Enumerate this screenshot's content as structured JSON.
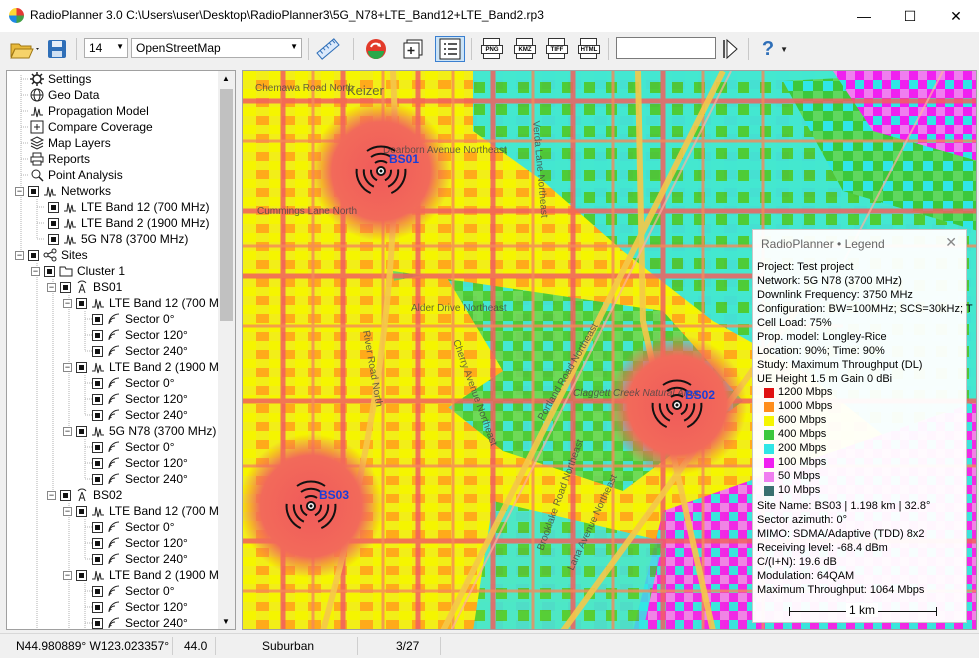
{
  "window": {
    "title": "RadioPlanner 3.0 C:\\Users\\user\\Desktop\\RadioPlanner3\\5G_N78+LTE_Band12+LTE_Band2.rp3",
    "minimize": "—",
    "maximize": "☐",
    "close": "✕"
  },
  "toolbar": {
    "zoom_value": "14",
    "map_source": "OpenStreetMap",
    "export_formats": [
      "PNG",
      "KMZ",
      "TIFF",
      "HTML"
    ],
    "search_value": "",
    "help_icon": "?"
  },
  "tree": {
    "items": [
      {
        "label": "Settings",
        "icon": "gear-icon"
      },
      {
        "label": "Geo Data",
        "icon": "globe-icon"
      },
      {
        "label": "Propagation Model",
        "icon": "wave-icon"
      },
      {
        "label": "Compare Coverage",
        "icon": "compare-icon"
      },
      {
        "label": "Map Layers",
        "icon": "layers-icon"
      },
      {
        "label": "Reports",
        "icon": "printer-icon"
      },
      {
        "label": "Point Analysis",
        "icon": "point-icon"
      },
      {
        "label": "Networks",
        "icon": "network-icon"
      },
      {
        "label": "LTE Band 12 (700 MHz)",
        "icon": "signal-icon"
      },
      {
        "label": "LTE Band 2 (1900 MHz)",
        "icon": "signal-icon"
      },
      {
        "label": "5G N78 (3700 MHz)",
        "icon": "signal-icon"
      },
      {
        "label": "Sites",
        "icon": "share-icon"
      },
      {
        "label": "Cluster 1",
        "icon": "folder-icon"
      },
      {
        "label": "BS01",
        "icon": "antenna-icon"
      },
      {
        "label": "LTE Band 12 (700 M",
        "icon": "signal-icon"
      },
      {
        "label": "Sector 0°",
        "icon": "sector-icon"
      },
      {
        "label": "Sector 120°",
        "icon": "sector-icon"
      },
      {
        "label": "Sector 240°",
        "icon": "sector-icon"
      },
      {
        "label": "LTE Band 2 (1900 M",
        "icon": "signal-icon"
      },
      {
        "label": "Sector 0°",
        "icon": "sector-icon"
      },
      {
        "label": "Sector 120°",
        "icon": "sector-icon"
      },
      {
        "label": "Sector 240°",
        "icon": "sector-icon"
      },
      {
        "label": "5G N78 (3700 MHz)",
        "icon": "signal-icon"
      },
      {
        "label": "Sector 0°",
        "icon": "sector-icon"
      },
      {
        "label": "Sector 120°",
        "icon": "sector-icon"
      },
      {
        "label": "Sector 240°",
        "icon": "sector-icon"
      },
      {
        "label": "BS02",
        "icon": "antenna-icon"
      },
      {
        "label": "LTE Band 12 (700 M",
        "icon": "signal-icon"
      },
      {
        "label": "Sector 0°",
        "icon": "sector-icon"
      },
      {
        "label": "Sector 120°",
        "icon": "sector-icon"
      },
      {
        "label": "Sector 240°",
        "icon": "sector-icon"
      },
      {
        "label": "LTE Band 2 (1900 M",
        "icon": "signal-icon"
      },
      {
        "label": "Sector 0°",
        "icon": "sector-icon"
      },
      {
        "label": "Sector 120°",
        "icon": "sector-icon"
      },
      {
        "label": "Sector 240°",
        "icon": "sector-icon"
      }
    ]
  },
  "map": {
    "street_labels": [
      "Chemawa Road North",
      "Keizer",
      "Dearborn Avenue Northeast",
      "Cummings Lane North",
      "Alder Drive Northeast",
      "River Road North",
      "Cherry Avenue Northeast",
      "Verda Lane Northeast",
      "Portland Road Northeast",
      "Claggett Creek Natural Area",
      "Lana Avenue Northeast",
      "Brooklake Road Northeast"
    ],
    "base_stations": [
      "BS01",
      "BS02",
      "BS03"
    ]
  },
  "legend": {
    "title": "RadioPlanner • Legend",
    "close": "✕",
    "lines": [
      "Project: Test project",
      "Network: 5G N78 (3700 MHz)",
      "Downlink Frequency: 3750 MHz",
      "Configuration: BW=100MHz; SCS=30kHz; T",
      "Cell Load: 75%",
      "Prop. model: Longley-Rice",
      "Location: 90%; Time: 90%",
      "Study: Maximum Throughput (DL)",
      "UE  Height 1.5 m  Gain 0 dBi"
    ],
    "scale": [
      {
        "label": "1200 Mbps",
        "color": "#e01010"
      },
      {
        "label": "1000 Mbps",
        "color": "#ff8c1a"
      },
      {
        "label": "600 Mbps",
        "color": "#f5f500"
      },
      {
        "label": "400 Mbps",
        "color": "#3cc83c"
      },
      {
        "label": "200 Mbps",
        "color": "#30e6e6"
      },
      {
        "label": "100 Mbps",
        "color": "#f020f0"
      },
      {
        "label": "50 Mbps",
        "color": "#f07ef0"
      },
      {
        "label": "10 Mbps",
        "color": "#3a7070"
      }
    ],
    "site_lines": [
      "Site Name: BS03 | 1.198 km | 32.8°",
      "Sector azimuth: 0°",
      "MIMO: SDMA/Adaptive (TDD) 8x2",
      "Receiving level: -68.4 dBm",
      "C/(I+N): 19.6 dB",
      "Modulation: 64QAM",
      "Maximum Throughput: 1064 Mbps"
    ],
    "scale_bar": "1 km"
  },
  "status": {
    "coords": "N44.980889°  W123.023357°",
    "elevation": "44.0",
    "clutter": "Suburban",
    "page": "3/27"
  }
}
